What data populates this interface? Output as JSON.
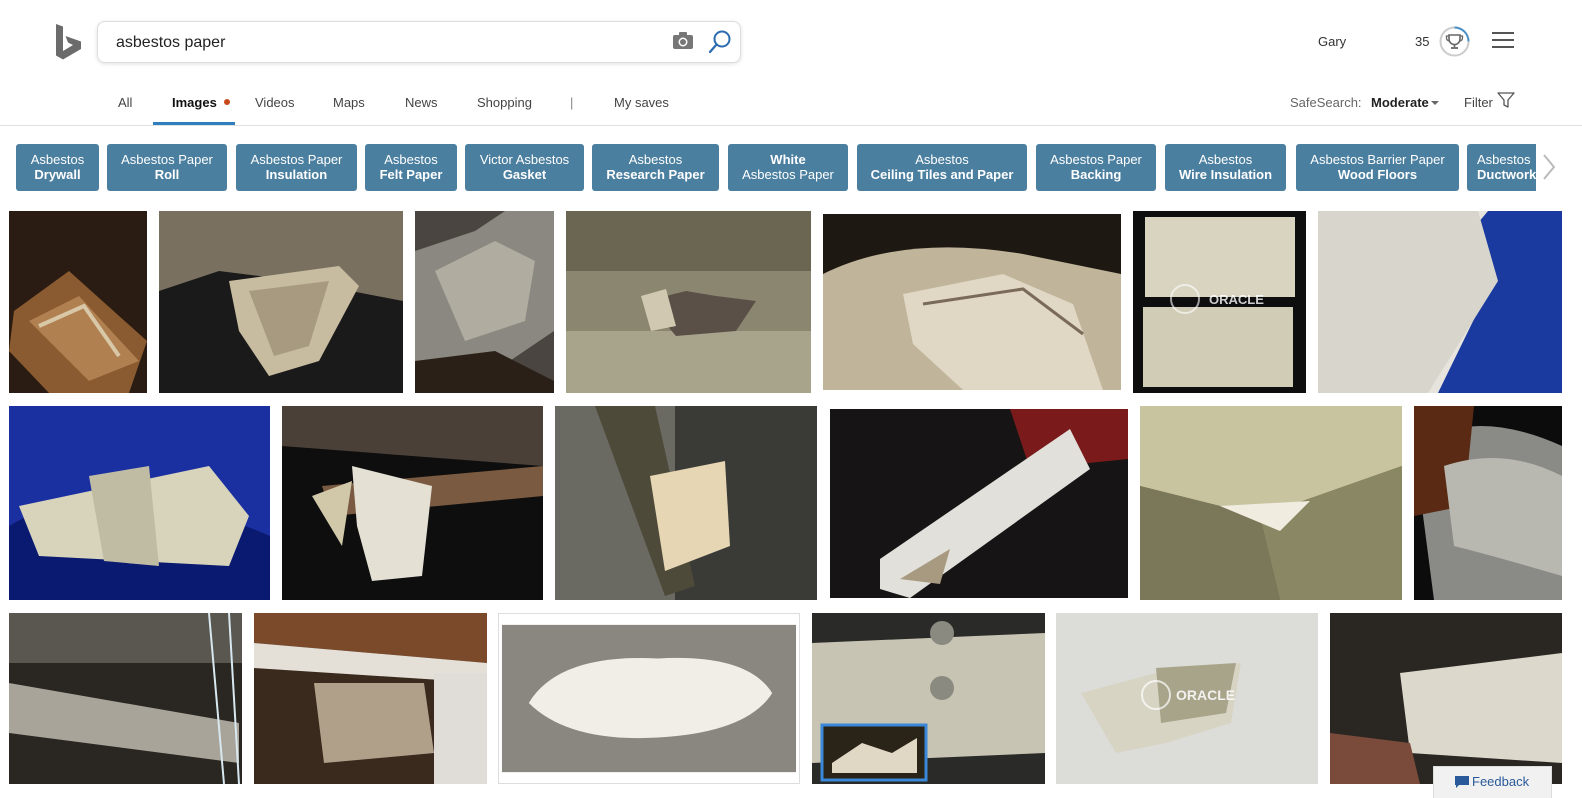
{
  "search": {
    "query": "asbestos paper"
  },
  "user": {
    "name": "Gary",
    "points": "35"
  },
  "nav": {
    "items": [
      {
        "label": "All"
      },
      {
        "label": "Images"
      },
      {
        "label": "Videos"
      },
      {
        "label": "Maps"
      },
      {
        "label": "News"
      },
      {
        "label": "Shopping"
      },
      {
        "label": "|"
      },
      {
        "label": "My saves"
      }
    ],
    "safesearch_label": "SafeSearch:",
    "safesearch_value": "Moderate",
    "filter_label": "Filter"
  },
  "related": [
    {
      "line1": "Asbestos",
      "line2": "Drywall"
    },
    {
      "line1": "Asbestos Paper",
      "line2": "Roll"
    },
    {
      "line1": "Asbestos Paper",
      "line2": "Insulation"
    },
    {
      "line1": "Asbestos",
      "line2": "Felt Paper"
    },
    {
      "line1": "Victor Asbestos",
      "line2": "Gasket"
    },
    {
      "line1": "Asbestos",
      "line2": "Research Paper"
    },
    {
      "line1": "White",
      "line2": "Asbestos Paper"
    },
    {
      "line1": "Asbestos",
      "line2": "Ceiling Tiles and Paper"
    },
    {
      "line1": "Asbestos Paper",
      "line2": "Backing"
    },
    {
      "line1": "Asbestos",
      "line2": "Wire Insulation"
    },
    {
      "line1": "Asbestos Barrier Paper",
      "line2": "Wood Floors"
    },
    {
      "line1": "Asbestos",
      "line2": "Ductwork"
    }
  ],
  "watermark": "ORACLE",
  "feedback_label": "Feedback",
  "colors": {
    "chip": "#4b7fa0",
    "active_tab": "#2f7fc0",
    "dot": "#c64a1c"
  }
}
